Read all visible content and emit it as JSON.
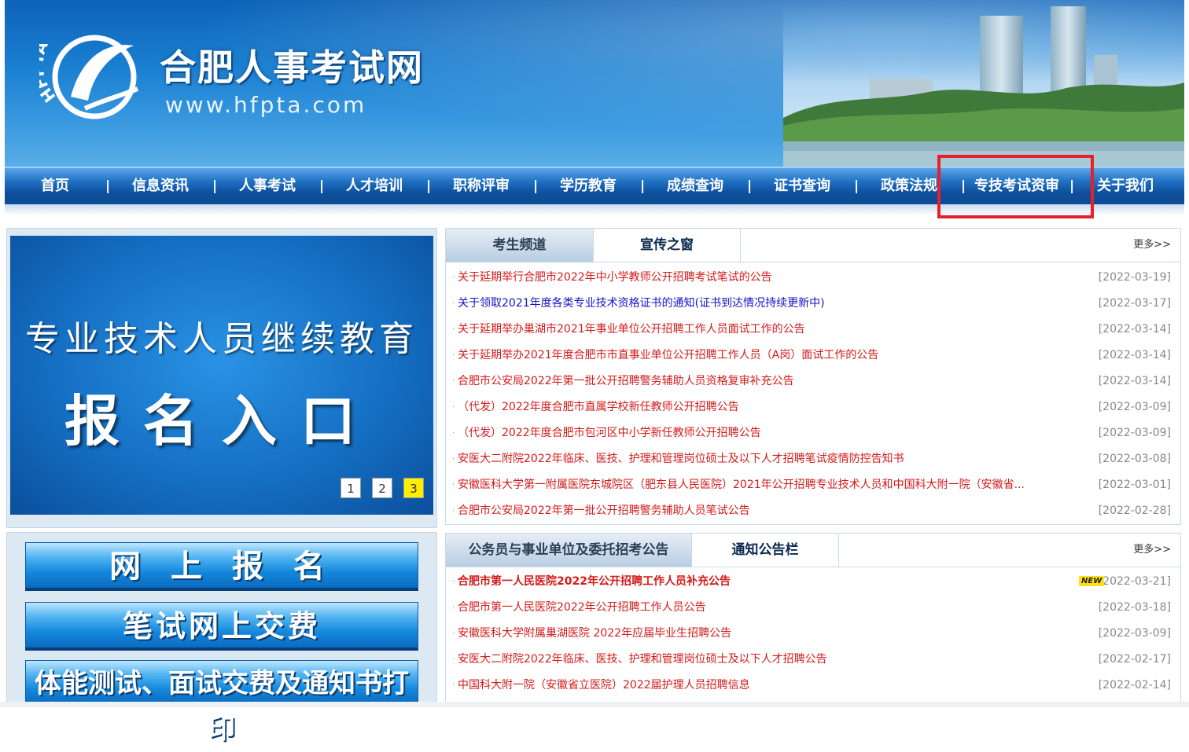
{
  "site": {
    "name": "合肥人事考试网",
    "url": "www.hfpta.com",
    "logo_text": "HFPTA"
  },
  "nav": {
    "items": [
      {
        "label": "首页"
      },
      {
        "label": "信息资讯"
      },
      {
        "label": "人事考试"
      },
      {
        "label": "人才培训"
      },
      {
        "label": "职称评审"
      },
      {
        "label": "学历教育"
      },
      {
        "label": "成绩查询"
      },
      {
        "label": "证书查询"
      },
      {
        "label": "政策法规"
      },
      {
        "label": "专技考试资审"
      },
      {
        "label": "关于我们"
      }
    ],
    "separator": "|"
  },
  "banner": {
    "line1": "专业技术人员继续教育",
    "line2": "报名入口",
    "slides": [
      "1",
      "2",
      "3"
    ],
    "active_slide": "3"
  },
  "quick_buttons": [
    {
      "label": "网 上 报 名"
    },
    {
      "label": "笔试网上交费"
    },
    {
      "label": "体能测试、面试交费及通知书打印"
    }
  ],
  "panel1": {
    "tabs": [
      {
        "label": "考生频道"
      },
      {
        "label": "宣传之窗"
      }
    ],
    "more": "更多>>",
    "items": [
      {
        "title": "关于延期举行合肥市2022年中小学教师公开招聘考试笔试的公告",
        "date": "[2022-03-19]",
        "color": "red"
      },
      {
        "title": "关于领取2021年度各类专业技术资格证书的通知(证书到达情况持续更新中)",
        "date": "[2022-03-17]",
        "color": "blue"
      },
      {
        "title": "关于延期举办巢湖市2021年事业单位公开招聘工作人员面试工作的公告",
        "date": "[2022-03-14]",
        "color": "red"
      },
      {
        "title": "关于延期举办2021年度合肥市市直事业单位公开招聘工作人员（A岗）面试工作的公告",
        "date": "[2022-03-14]",
        "color": "red"
      },
      {
        "title": "合肥市公安局2022年第一批公开招聘警务辅助人员资格复审补充公告",
        "date": "[2022-03-14]",
        "color": "red"
      },
      {
        "title": "（代发）2022年度合肥市直属学校新任教师公开招聘公告",
        "date": "[2022-03-09]",
        "color": "red"
      },
      {
        "title": "（代发）2022年度合肥市包河区中小学新任教师公开招聘公告",
        "date": "[2022-03-09]",
        "color": "red"
      },
      {
        "title": "安医大二附院2022年临床、医技、护理和管理岗位硕士及以下人才招聘笔试疫情防控告知书",
        "date": "[2022-03-08]",
        "color": "red"
      },
      {
        "title": "安徽医科大学第一附属医院东城院区（肥东县人民医院）2021年公开招聘专业技术人员和中国科大附一院（安徽省...",
        "date": "[2022-03-01]",
        "color": "red"
      },
      {
        "title": "合肥市公安局2022年第一批公开招聘警务辅助人员笔试公告",
        "date": "[2022-02-28]",
        "color": "red"
      }
    ]
  },
  "panel2": {
    "tabs": [
      {
        "label": "公务员与事业单位及委托招考公告"
      },
      {
        "label": "通知公告栏"
      }
    ],
    "more": "更多>>",
    "new_badge": "NEW",
    "items": [
      {
        "title": "合肥市第一人民医院2022年公开招聘工作人员补充公告",
        "date": "[2022-03-21]",
        "color": "red"
      },
      {
        "title": "合肥市第一人民医院2022年公开招聘工作人员公告",
        "date": "[2022-03-18]",
        "color": "red"
      },
      {
        "title": "安徽医科大学附属巢湖医院 2022年应届毕业生招聘公告",
        "date": "[2022-03-09]",
        "color": "red"
      },
      {
        "title": "安医大二附院2022年临床、医技、护理和管理岗位硕士及以下人才招聘公告",
        "date": "[2022-02-17]",
        "color": "red"
      },
      {
        "title": "中国科大附一院（安徽省立医院）2022届护理人员招聘信息",
        "date": "[2022-02-14]",
        "color": "red"
      }
    ]
  }
}
